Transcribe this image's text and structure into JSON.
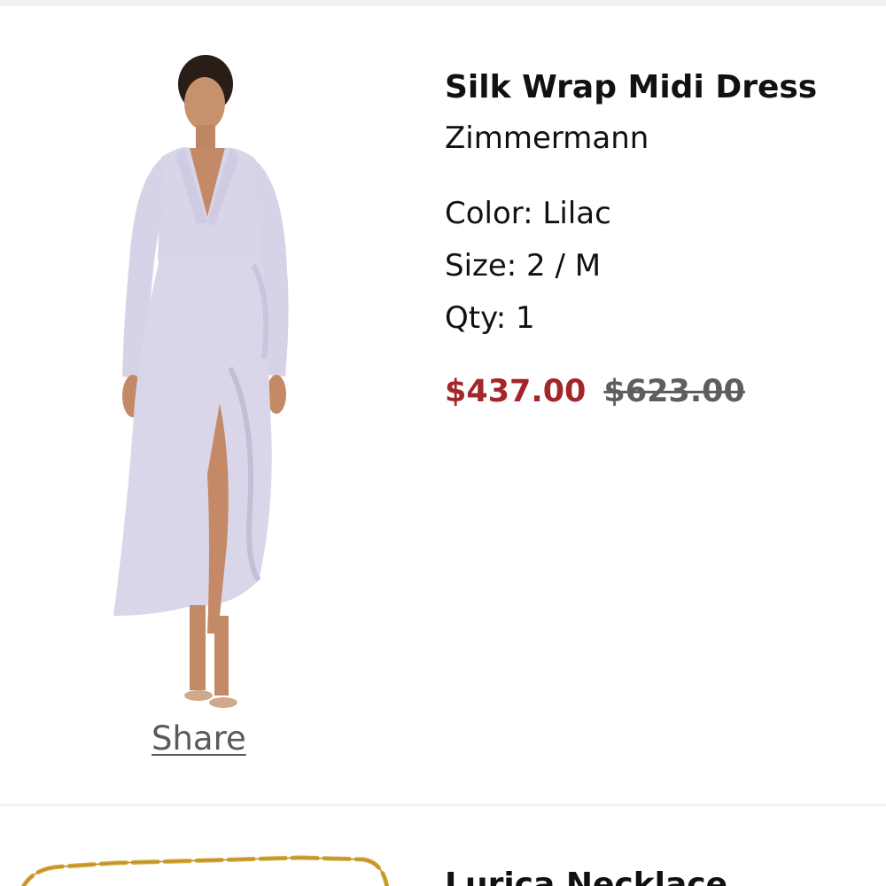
{
  "items": [
    {
      "title": "Silk Wrap Midi Dress",
      "brand": "Zimmermann",
      "color_label": "Color: Lilac",
      "size_label": "Size: 2 / M",
      "qty_label": "Qty: 1",
      "sale_price": "$437.00",
      "original_price": "$623.00",
      "share_label": "Share",
      "dress_color": "#d9d6ea"
    },
    {
      "title": "Lurica Necklace",
      "chain_color": "#d4a93a"
    }
  ],
  "colors": {
    "sale_price": "#a3262a",
    "original_price": "#5e5e5e",
    "divider": "#f1f1f1"
  }
}
